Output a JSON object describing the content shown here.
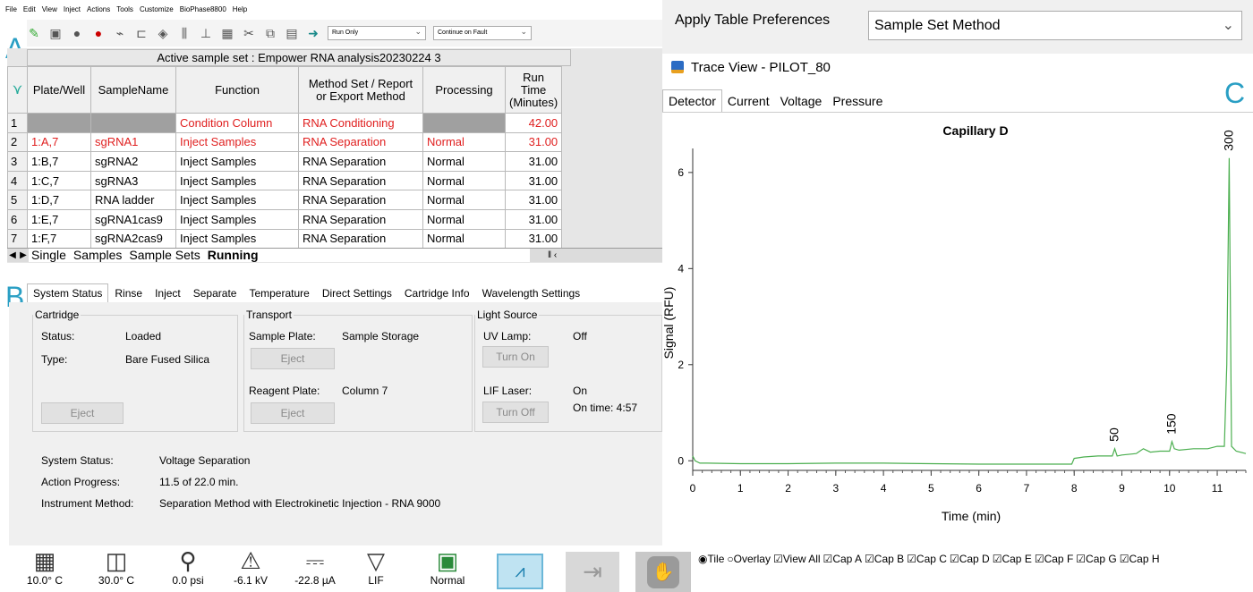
{
  "menu": [
    "File",
    "Edit",
    "View",
    "Inject",
    "Actions",
    "Tools",
    "Customize",
    "BioPhase8800",
    "Help"
  ],
  "toolbar": {
    "icons": [
      "new-icon",
      "save-icon",
      "stop-icon",
      "record-icon",
      "pipette-icon",
      "tray-icon",
      "tag-icon",
      "columns-icon",
      "chart-icon",
      "table-icon",
      "cut-icon",
      "copy-icon",
      "paste-icon",
      "go-icon"
    ],
    "run_mode": "Run Only",
    "fault_mode": "Continue on Fault"
  },
  "panel_labels": {
    "a": "A",
    "b": "B",
    "c": "C"
  },
  "sample_set": {
    "caption": "Active sample set : Empower RNA analysis20230224 3",
    "headers": {
      "plate": "Plate/Well",
      "name": "SampleName",
      "function": "Function",
      "method": "Method Set / Report or Export Method",
      "processing": "Processing",
      "runtime": "Run Time (Minutes)"
    },
    "rows": [
      {
        "n": "1",
        "plate": "",
        "name": "",
        "function": "Condition Column",
        "method": "RNA Conditioning",
        "processing": "",
        "runtime": "42.00"
      },
      {
        "n": "2",
        "plate": "1:A,7",
        "name": "sgRNA1",
        "function": "Inject Samples",
        "method": "RNA Separation",
        "processing": "Normal",
        "runtime": "31.00"
      },
      {
        "n": "3",
        "plate": "1:B,7",
        "name": "sgRNA2",
        "function": "Inject Samples",
        "method": "RNA Separation",
        "processing": "Normal",
        "runtime": "31.00"
      },
      {
        "n": "4",
        "plate": "1:C,7",
        "name": "sgRNA3",
        "function": "Inject Samples",
        "method": "RNA Separation",
        "processing": "Normal",
        "runtime": "31.00"
      },
      {
        "n": "5",
        "plate": "1:D,7",
        "name": "RNA ladder",
        "function": "Inject Samples",
        "method": "RNA Separation",
        "processing": "Normal",
        "runtime": "31.00"
      },
      {
        "n": "6",
        "plate": "1:E,7",
        "name": "sgRNA1cas9",
        "function": "Inject Samples",
        "method": "RNA Separation",
        "processing": "Normal",
        "runtime": "31.00"
      },
      {
        "n": "7",
        "plate": "1:F,7",
        "name": "sgRNA2cas9",
        "function": "Inject Samples",
        "method": "RNA Separation",
        "processing": "Normal",
        "runtime": "31.00"
      }
    ],
    "sheet_tabs": [
      "Single",
      "Samples",
      "Sample Sets",
      "Running"
    ],
    "active_sheet": "Running"
  },
  "status_tabs": [
    "System Status",
    "Rinse",
    "Inject",
    "Separate",
    "Temperature",
    "Direct Settings",
    "Cartridge Info",
    "Wavelength Settings"
  ],
  "cartridge": {
    "legend": "Cartridge",
    "status_label": "Status:",
    "status": "Loaded",
    "type_label": "Type:",
    "type": "Bare Fused Silica",
    "eject": "Eject"
  },
  "transport": {
    "legend": "Transport",
    "sample_plate_label": "Sample Plate:",
    "sample_plate": "Sample Storage",
    "eject1": "Eject",
    "reagent_plate_label": "Reagent Plate:",
    "reagent_plate": "Column 7",
    "eject2": "Eject"
  },
  "light_source": {
    "legend": "Light Source",
    "uv_label": "UV Lamp:",
    "uv": "Off",
    "uv_btn": "Turn On",
    "lif_label": "LIF Laser:",
    "lif": "On",
    "lif_btn": "Turn Off",
    "lif_time": "On time: 4:57"
  },
  "system": {
    "status_label": "System Status:",
    "status": "Voltage Separation",
    "progress_label": "Action Progress:",
    "progress": "11.5 of 22.0 min.",
    "method_label": "Instrument Method:",
    "method": "Separation Method with Electrokinetic Injection - RNA 9000"
  },
  "footer": [
    {
      "icon": "plate-temp-icon",
      "value": "10.0° C"
    },
    {
      "icon": "cartridge-temp-icon",
      "value": "30.0° C"
    },
    {
      "icon": "pressure-icon",
      "value": "0.0 psi"
    },
    {
      "icon": "voltage-icon",
      "value": "-6.1 kV"
    },
    {
      "icon": "current-icon",
      "value": "-22.8 µA"
    },
    {
      "icon": "lif-icon",
      "value": "LIF"
    },
    {
      "icon": "reagent-icon",
      "value": "Normal"
    }
  ],
  "right_top": {
    "prefs_label": "Apply Table Preferences",
    "prefs_value": "Sample Set Method"
  },
  "trace": {
    "title": "Trace View - PILOT_80",
    "tabs": [
      "Detector",
      "Current",
      "Voltage",
      "Pressure"
    ],
    "active_tab": "Detector"
  },
  "chart_data": {
    "type": "line",
    "title": "Capillary D",
    "xlabel": "Time (min)",
    "ylabel": "Signal (RFU)",
    "xlim": [
      0,
      11.6
    ],
    "ylim": [
      -0.2,
      6.5
    ],
    "xticks": [
      0,
      1,
      2,
      3,
      4,
      5,
      6,
      7,
      8,
      9,
      10,
      11
    ],
    "yticks": [
      0,
      2,
      4,
      6
    ],
    "series": [
      {
        "color": "#4caf50",
        "x": [
          0,
          0.05,
          0.15,
          0.3,
          1,
          2,
          3,
          4,
          5,
          6,
          7,
          7.95,
          8.0,
          8.2,
          8.5,
          8.8,
          8.85,
          8.9,
          9.0,
          9.3,
          9.45,
          9.6,
          9.8,
          10.0,
          10.05,
          10.1,
          10.2,
          10.5,
          10.8,
          11.0,
          11.15,
          11.2,
          11.25,
          11.3,
          11.4,
          11.6
        ],
        "y": [
          0.1,
          0.0,
          -0.05,
          -0.05,
          -0.06,
          -0.06,
          -0.05,
          -0.05,
          -0.06,
          -0.07,
          -0.07,
          -0.07,
          0.05,
          0.08,
          0.1,
          0.1,
          0.25,
          0.1,
          0.12,
          0.15,
          0.25,
          0.18,
          0.2,
          0.2,
          0.4,
          0.25,
          0.22,
          0.25,
          0.25,
          0.3,
          0.3,
          2.0,
          6.3,
          0.3,
          0.2,
          0.15
        ]
      }
    ],
    "annotations": [
      {
        "x": 8.85,
        "y": 0.25,
        "text": "50"
      },
      {
        "x": 10.05,
        "y": 0.4,
        "text": "150"
      },
      {
        "x": 11.25,
        "y": 6.3,
        "text": "300"
      }
    ]
  },
  "cap_options": {
    "tile": "Tile",
    "overlay": "Overlay",
    "view_all": "View All",
    "caps": [
      "Cap  A",
      "Cap  B",
      "Cap  C",
      "Cap  D",
      "Cap  E",
      "Cap  F",
      "Cap  G",
      "Cap  H"
    ]
  }
}
